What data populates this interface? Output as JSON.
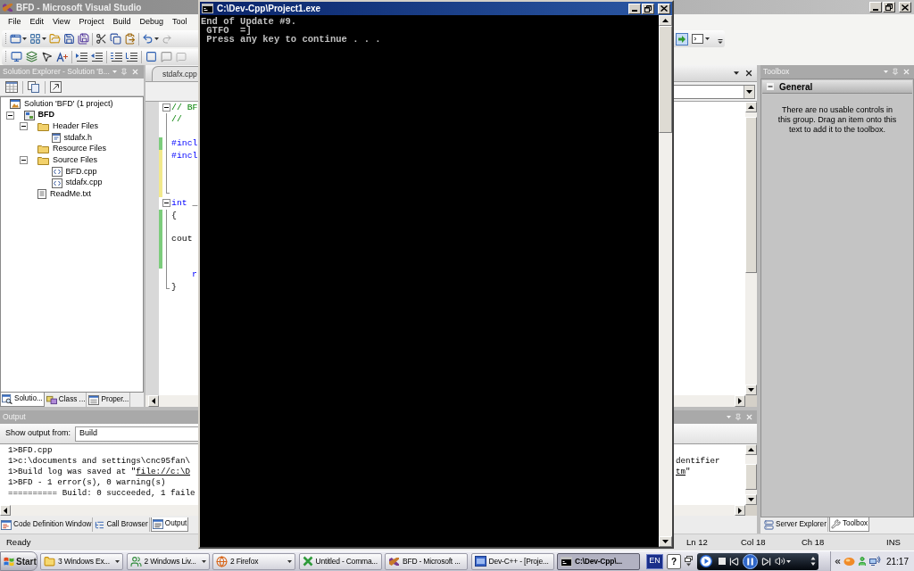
{
  "ide": {
    "title": "BFD - Microsoft Visual Studio",
    "menu": [
      "File",
      "Edit",
      "View",
      "Project",
      "Build",
      "Debug",
      "Tool"
    ],
    "solution_explorer": {
      "title": "Solution Explorer - Solution 'B...",
      "tree": [
        {
          "label": "Solution 'BFD' (1 project)",
          "kind": "solution",
          "children": [
            {
              "label": "BFD",
              "kind": "project",
              "expanded": true,
              "children": [
                {
                  "label": "Header Files",
                  "kind": "folder",
                  "expanded": true,
                  "children": [
                    {
                      "label": "stdafx.h",
                      "kind": "header"
                    }
                  ]
                },
                {
                  "label": "Resource Files",
                  "kind": "folder"
                },
                {
                  "label": "Source Files",
                  "kind": "folder",
                  "expanded": true,
                  "children": [
                    {
                      "label": "BFD.cpp",
                      "kind": "source"
                    },
                    {
                      "label": "stdafx.cpp",
                      "kind": "source"
                    }
                  ]
                },
                {
                  "label": "ReadMe.txt",
                  "kind": "text"
                }
              ]
            }
          ]
        }
      ],
      "tabs": [
        {
          "label": "Solutio...",
          "kind": "solution-explorer",
          "selected": true
        },
        {
          "label": "Class ...",
          "kind": "class-view",
          "selected": false
        },
        {
          "label": "Proper...",
          "kind": "properties",
          "selected": false
        }
      ]
    },
    "editor": {
      "tabs": [
        {
          "label": "stdafx.cpp",
          "selected": false
        }
      ],
      "lines": [
        {
          "tokens": [
            {
              "text": "// BF",
              "kind": "comment"
            }
          ],
          "fold": true,
          "modified": false
        },
        {
          "tokens": [
            {
              "text": "//",
              "kind": "comment"
            }
          ],
          "modified": false
        },
        {
          "modified": false
        },
        {
          "tokens": [
            {
              "text": "#incl",
              "kind": "keyword"
            }
          ],
          "modified": true,
          "saved": true
        },
        {
          "tokens": [
            {
              "text": "#incl",
              "kind": "keyword"
            }
          ],
          "modified": true,
          "saved": false
        },
        {
          "modified": true,
          "saved": false
        },
        {
          "modified": true,
          "saved": false
        },
        {
          "modified": true,
          "saved": false
        },
        {
          "tokens": [
            {
              "text": "int",
              "kind": "keyword"
            },
            {
              "text": " _",
              "kind": "plain"
            }
          ],
          "fold": true,
          "modified": false
        },
        {
          "tokens": [
            {
              "text": "{",
              "kind": "plain"
            }
          ],
          "modified": true,
          "saved": true
        },
        {
          "modified": true,
          "saved": true
        },
        {
          "tokens": [
            {
              "text": "cout",
              "kind": "plain"
            }
          ],
          "modified": true,
          "saved": true
        },
        {
          "modified": true,
          "saved": true
        },
        {
          "modified": true,
          "saved": true
        },
        {
          "tokens": [
            {
              "text": "r",
              "kind": "keyword"
            }
          ],
          "indented": true,
          "modified": false
        },
        {
          "tokens": [
            {
              "text": "}",
              "kind": "plain"
            }
          ],
          "modified": false
        }
      ]
    },
    "output": {
      "title": "Output",
      "source_label": "Show output from:",
      "source": "Build",
      "lines": [
        {
          "text": "1>BFD.cpp"
        },
        {
          "text": "1>c:\\documents and settings\\cnc95fan\\",
          "tail": "dentifier"
        },
        {
          "text": "1>Build log was saved at \"",
          "link": "file://c:\\D",
          "tail_link": "tm",
          "tail": "\""
        },
        {
          "text": "1>BFD - 1 error(s), 0 warning(s)"
        },
        {
          "text": "========== Build: 0 succeeded, 1 faile"
        }
      ]
    },
    "output_tabs": [
      {
        "label": "Code Definition Window",
        "kind": "code-definition",
        "selected": false
      },
      {
        "label": "Call Browser",
        "kind": "call-browser",
        "selected": false
      },
      {
        "label": "Output",
        "kind": "output",
        "selected": true
      }
    ],
    "toolbox": {
      "title": "Toolbox",
      "group": {
        "label": "General",
        "expanded": true
      },
      "message": "There are no usable controls in this group. Drag an item onto this text to add it to the toolbox."
    },
    "toolbox_tabs": [
      {
        "label": "Server Explorer",
        "kind": "server-explorer",
        "selected": false
      },
      {
        "label": "Toolbox",
        "kind": "toolbox",
        "selected": true
      }
    ],
    "status_bar": {
      "message": "Ready",
      "line": "Ln 12",
      "column": "Col 18",
      "character": "Ch 18",
      "mode": "INS"
    }
  },
  "console": {
    "title": "C:\\Dev-Cpp\\Project1.exe",
    "lines": [
      "End of Update #9.",
      " GTFO  =]",
      " Press any key to continue . . ."
    ]
  },
  "taskbar": {
    "start": "Start",
    "buttons": [
      {
        "label": "3 Windows Ex...",
        "kind": "folder",
        "grouped": true,
        "selected": false
      },
      {
        "label": "2 Windows Liv...",
        "kind": "messenger",
        "grouped": true,
        "selected": false
      },
      {
        "label": "2 Firefox",
        "kind": "browser",
        "grouped": true,
        "selected": false
      },
      {
        "label": "Untitled - Comma...",
        "kind": "editor",
        "grouped": false,
        "selected": false
      },
      {
        "label": "BFD - Microsoft ...",
        "kind": "ide",
        "grouped": false,
        "selected": false
      },
      {
        "label": "Dev-C++ - [Proje...",
        "kind": "devcpp",
        "grouped": false,
        "selected": false
      },
      {
        "label": "C:\\Dev-Cpp\\...",
        "kind": "console",
        "grouped": false,
        "selected": true
      }
    ],
    "language": "EN",
    "help": "?",
    "clock": "21:17"
  }
}
